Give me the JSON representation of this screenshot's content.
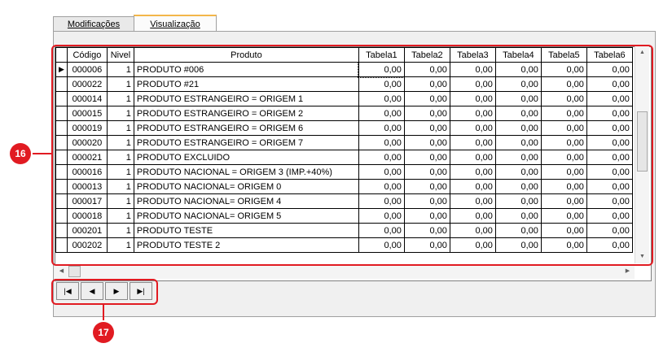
{
  "tabs": [
    {
      "label": "Modificações",
      "active": false
    },
    {
      "label": "Visualização",
      "active": true
    }
  ],
  "grid": {
    "columns": [
      "Código",
      "Nivel",
      "Produto",
      "Tabela1",
      "Tabela2",
      "Tabela3",
      "Tabela4",
      "Tabela5",
      "Tabela6"
    ],
    "rows": [
      {
        "codigo": "000006",
        "nivel": "1",
        "produto": "PRODUTO #006",
        "tabelas": [
          "0,00",
          "0,00",
          "0,00",
          "0,00",
          "0,00",
          "0,00"
        ]
      },
      {
        "codigo": "000022",
        "nivel": "1",
        "produto": "PRODUTO #21",
        "tabelas": [
          "0,00",
          "0,00",
          "0,00",
          "0,00",
          "0,00",
          "0,00"
        ]
      },
      {
        "codigo": "000014",
        "nivel": "1",
        "produto": "PRODUTO ESTRANGEIRO = ORIGEM 1",
        "tabelas": [
          "0,00",
          "0,00",
          "0,00",
          "0,00",
          "0,00",
          "0,00"
        ]
      },
      {
        "codigo": "000015",
        "nivel": "1",
        "produto": "PRODUTO ESTRANGEIRO = ORIGEM 2",
        "tabelas": [
          "0,00",
          "0,00",
          "0,00",
          "0,00",
          "0,00",
          "0,00"
        ]
      },
      {
        "codigo": "000019",
        "nivel": "1",
        "produto": "PRODUTO ESTRANGEIRO = ORIGEM 6",
        "tabelas": [
          "0,00",
          "0,00",
          "0,00",
          "0,00",
          "0,00",
          "0,00"
        ]
      },
      {
        "codigo": "000020",
        "nivel": "1",
        "produto": "PRODUTO ESTRANGEIRO = ORIGEM 7",
        "tabelas": [
          "0,00",
          "0,00",
          "0,00",
          "0,00",
          "0,00",
          "0,00"
        ]
      },
      {
        "codigo": "000021",
        "nivel": "1",
        "produto": "PRODUTO EXCLUIDO",
        "tabelas": [
          "0,00",
          "0,00",
          "0,00",
          "0,00",
          "0,00",
          "0,00"
        ]
      },
      {
        "codigo": "000016",
        "nivel": "1",
        "produto": "PRODUTO NACIONAL = ORIGEM 3 (IMP.+40%)",
        "tabelas": [
          "0,00",
          "0,00",
          "0,00",
          "0,00",
          "0,00",
          "0,00"
        ]
      },
      {
        "codigo": "000013",
        "nivel": "1",
        "produto": "PRODUTO NACIONAL= ORIGEM 0",
        "tabelas": [
          "0,00",
          "0,00",
          "0,00",
          "0,00",
          "0,00",
          "0,00"
        ]
      },
      {
        "codigo": "000017",
        "nivel": "1",
        "produto": "PRODUTO NACIONAL= ORIGEM 4",
        "tabelas": [
          "0,00",
          "0,00",
          "0,00",
          "0,00",
          "0,00",
          "0,00"
        ]
      },
      {
        "codigo": "000018",
        "nivel": "1",
        "produto": "PRODUTO NACIONAL= ORIGEM 5",
        "tabelas": [
          "0,00",
          "0,00",
          "0,00",
          "0,00",
          "0,00",
          "0,00"
        ]
      },
      {
        "codigo": "000201",
        "nivel": "1",
        "produto": "PRODUTO TESTE",
        "tabelas": [
          "0,00",
          "0,00",
          "0,00",
          "0,00",
          "0,00",
          "0,00"
        ]
      },
      {
        "codigo": "000202",
        "nivel": "1",
        "produto": "PRODUTO TESTE 2",
        "tabelas": [
          "0,00",
          "0,00",
          "0,00",
          "0,00",
          "0,00",
          "0,00"
        ]
      }
    ],
    "current_row_indicator": "▶"
  },
  "navigator": {
    "first": "|◀",
    "prior": "◀",
    "next": "▶",
    "last": "▶|"
  },
  "callouts": [
    {
      "label": "16"
    },
    {
      "label": "17"
    }
  ],
  "colors": {
    "callout": "#e11b22",
    "active_tab_accent": "#f3b64a"
  }
}
